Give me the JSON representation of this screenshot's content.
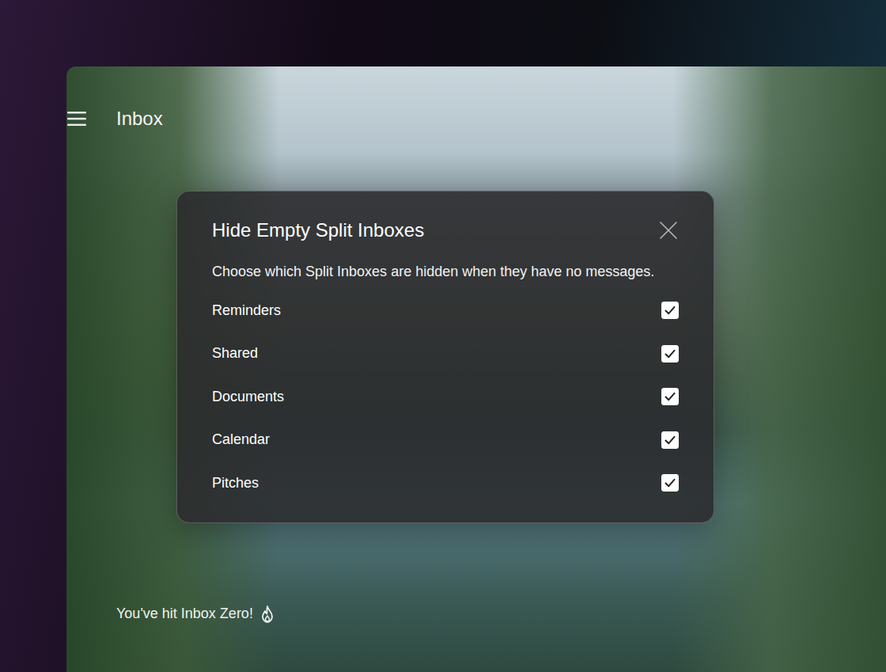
{
  "header": {
    "title": "Inbox"
  },
  "dialog": {
    "title": "Hide Empty Split Inboxes",
    "description": "Choose which Split Inboxes are hidden when they have no messages.",
    "options": [
      {
        "label": "Reminders",
        "checked": true
      },
      {
        "label": "Shared",
        "checked": true
      },
      {
        "label": "Documents",
        "checked": true
      },
      {
        "label": "Calendar",
        "checked": true
      },
      {
        "label": "Pitches",
        "checked": true
      }
    ]
  },
  "status": {
    "text": "You've hit Inbox Zero!"
  }
}
